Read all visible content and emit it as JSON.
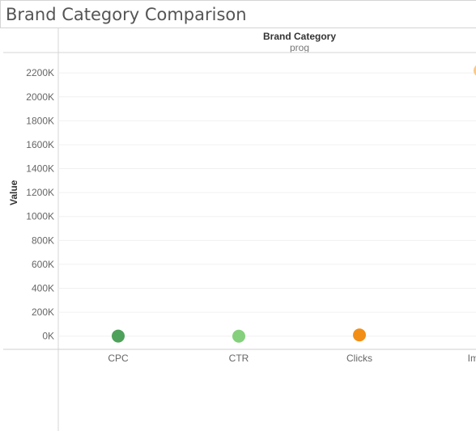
{
  "title": "Brand Category Comparison",
  "chart_data": {
    "type": "scatter",
    "title": "Brand Category Comparison",
    "header": "Brand Category",
    "subheader": "prog",
    "ylabel": "Value",
    "xlabel": "",
    "categories": [
      "CPC",
      "CTR",
      "Clicks",
      "Impre"
    ],
    "values": [
      1000,
      0,
      10000,
      2220000
    ],
    "colors": [
      "#4ea15a",
      "#85d07d",
      "#f28e16",
      "#f9c88b"
    ],
    "ylim": [
      -110000,
      2370000
    ],
    "yticks": [
      0,
      200000,
      400000,
      600000,
      800000,
      1000000,
      1200000,
      1400000,
      1600000,
      1800000,
      2000000,
      2200000
    ],
    "ytick_labels": [
      "0K",
      "200K",
      "400K",
      "600K",
      "800K",
      "1000K",
      "1200K",
      "1400K",
      "1600K",
      "1800K",
      "2000K",
      "2200K"
    ],
    "grid": true,
    "legend": "none"
  }
}
